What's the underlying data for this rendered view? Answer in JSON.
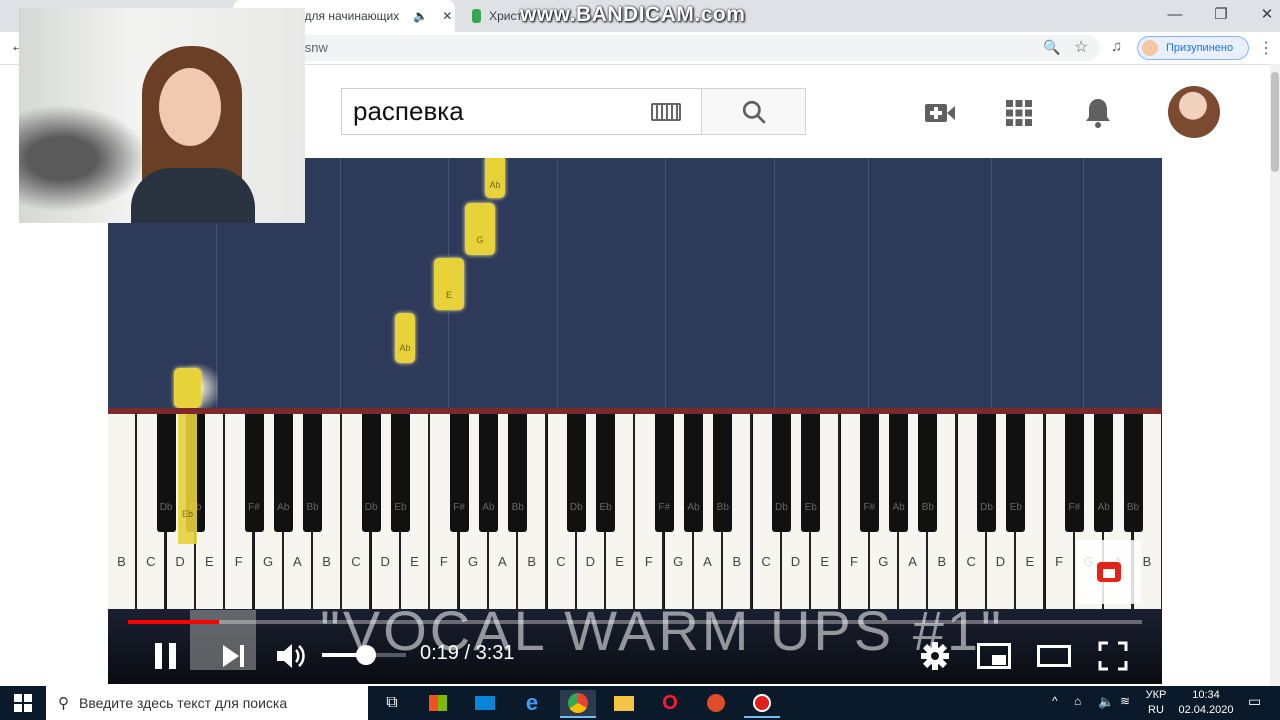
{
  "browser": {
    "tabs": [
      {
        "title": "ка для начинающих",
        "active": true
      },
      {
        "title": "Христ",
        "active": false
      }
    ],
    "address": "loKsnw",
    "profile_label": "Призупинено",
    "watermark": "www.BANDICAM.com"
  },
  "youtube": {
    "search_value": "распевка"
  },
  "video": {
    "title_overlay": "\"VOCAL WARM UPS #1\"",
    "time_current": "0:19",
    "time_total": "3:31",
    "progress_fraction": 0.09,
    "volume_fraction": 0.52,
    "white_keys": [
      "B",
      "C",
      "D",
      "E",
      "F",
      "G",
      "A",
      "B",
      "C",
      "D",
      "E",
      "F",
      "G",
      "A",
      "B",
      "C",
      "D",
      "E",
      "F",
      "G",
      "A",
      "B",
      "C",
      "D",
      "E",
      "F",
      "G",
      "A",
      "B",
      "C",
      "D",
      "E",
      "F",
      "G",
      "A",
      "B"
    ],
    "black_keys": [
      "Db",
      "Eb",
      "F#",
      "Ab",
      "Bb",
      "Db",
      "Eb",
      "F#",
      "Ab",
      "Bb",
      "Db",
      "Eb",
      "F#",
      "Ab",
      "Bb",
      "Db",
      "Eb",
      "F#",
      "Ab",
      "Bb",
      "Db",
      "Eb",
      "F#",
      "Ab",
      "Bb"
    ],
    "notes": [
      {
        "label": "Eb"
      },
      {
        "label": "Ab"
      },
      {
        "label": "E"
      },
      {
        "label": "G"
      },
      {
        "label": "Ab"
      }
    ]
  },
  "taskbar": {
    "search_placeholder": "Введите здесь текст для поиска",
    "lang_top": "УКР",
    "lang_bottom": "RU",
    "time": "10:34",
    "date": "02.04.2020"
  },
  "colors": {
    "accent": "#ff0000",
    "note": "#e8d23a",
    "video_bg": "#2e3a5a"
  }
}
